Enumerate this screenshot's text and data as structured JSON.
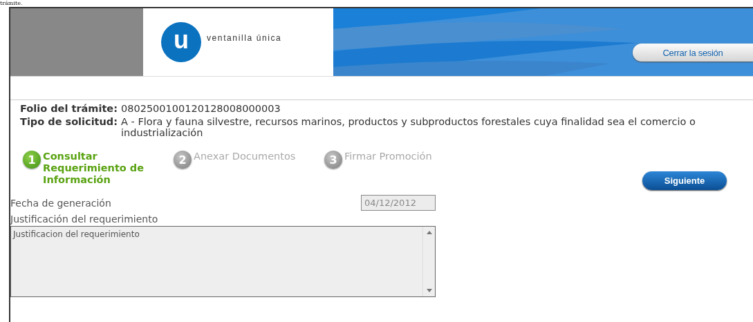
{
  "above_text": "trámite.",
  "header": {
    "logo_letter": "u",
    "logo_text": "ventanilla única",
    "logout_button": "Cerrar la sesión"
  },
  "details": [
    {
      "label": "Folio del trámite:",
      "value": "0802500100120128008000003"
    },
    {
      "label": "Tipo de solicitud:",
      "value": "A - Flora y fauna silvestre, recursos marinos, productos y subproductos forestales cuya finalidad sea el comercio o industrialización"
    }
  ],
  "steps": [
    {
      "number": "1",
      "label": "Consultar Requerimiento de Información",
      "selected": true
    },
    {
      "number": "2",
      "label": "Anexar Documentos",
      "selected": false
    },
    {
      "number": "3",
      "label": "Firmar Promoción",
      "selected": false
    }
  ],
  "next_button": "Siguiente",
  "form": {
    "date_label": "Fecha de generación",
    "date_value": "04/12/2012",
    "justification_label": "Justificación del requerimiento",
    "justification_value": "Justificacion del requerimiento"
  }
}
